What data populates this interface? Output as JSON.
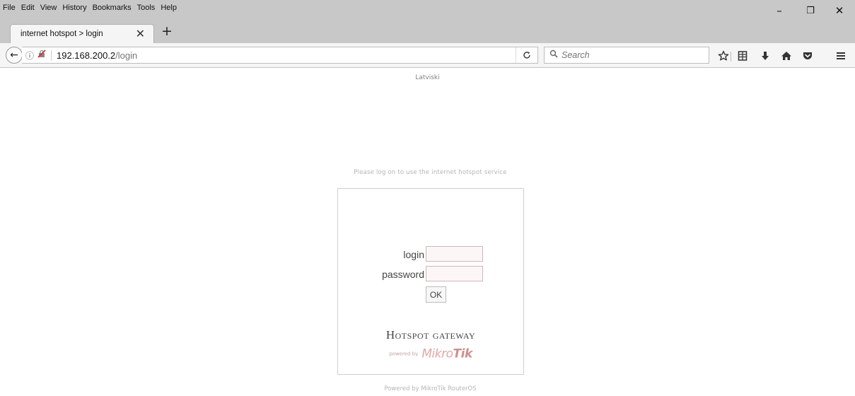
{
  "menu": [
    "File",
    "Edit",
    "View",
    "History",
    "Bookmarks",
    "Tools",
    "Help"
  ],
  "window_controls": {
    "minimize": "–",
    "restore": "❐",
    "close": "✕"
  },
  "tab": {
    "title": "internet hotspot > login",
    "close": "✕",
    "new_tab": "+"
  },
  "navbar": {
    "back": "←",
    "info": "ⓘ",
    "url_host": "192.168.200.2",
    "url_path": "/login",
    "reload": "C",
    "search_placeholder": "Search"
  },
  "toolbar_icons": [
    "star-icon",
    "reading-list-icon",
    "download-icon",
    "home-icon",
    "pocket-icon",
    "menu-icon"
  ],
  "page": {
    "language_link": "Latviski",
    "notice": "Please log on to use the internet hotspot service",
    "form": {
      "login_label": "login",
      "password_label": "password",
      "login_value": "",
      "password_value": "",
      "ok_label": "OK"
    },
    "gateway_title": "Hotspot gateway",
    "powered_by_small": "powered by",
    "brand_light": "Mikro",
    "brand_bold": "Tik",
    "footer": "Powered by MikroTik RouterOS"
  },
  "colors": {
    "chrome": "#c8c8c8",
    "navbar": "#f5f5f5",
    "brand": "#e2a6a6",
    "muted_text": "#b5b5b5"
  }
}
